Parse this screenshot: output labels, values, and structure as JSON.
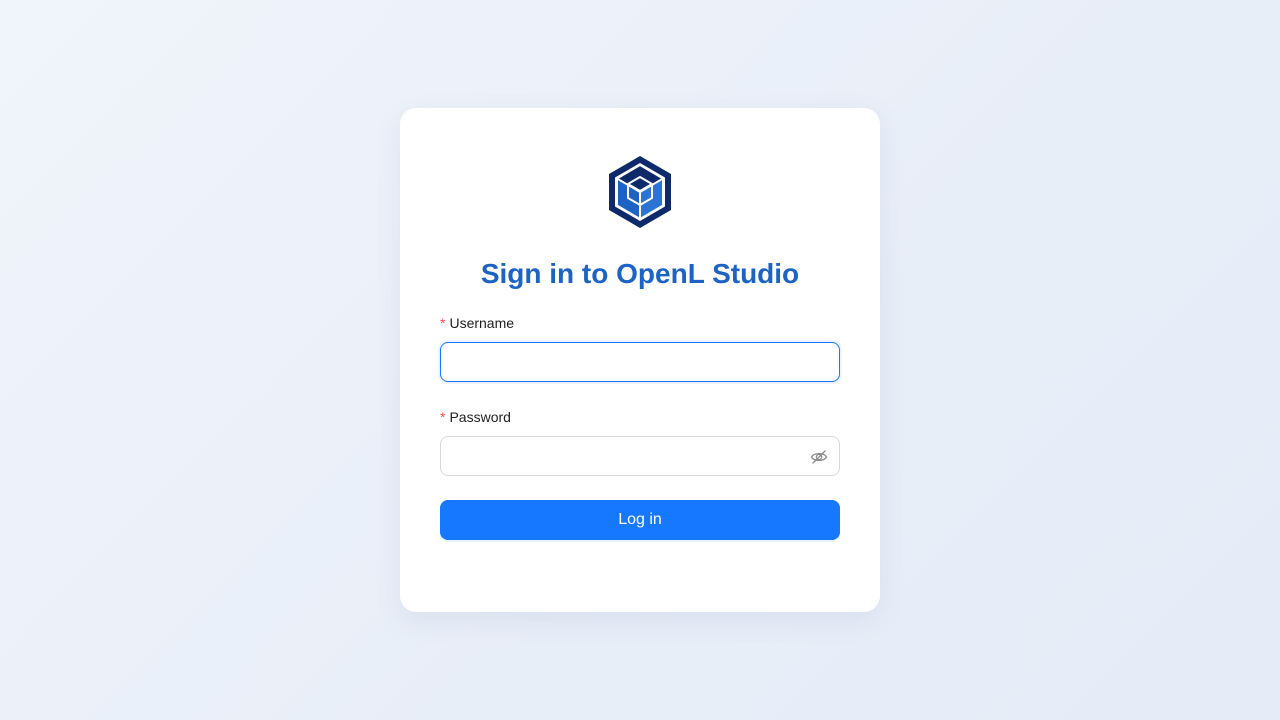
{
  "title": "Sign in to OpenL Studio",
  "logo": {
    "icon": "hexagon-cube-logo-icon",
    "color_dark": "#0f2a6b",
    "color_mid": "#1c63c4"
  },
  "form": {
    "username": {
      "label": "Username",
      "required_mark": "*",
      "value": "",
      "placeholder": "",
      "focused": true
    },
    "password": {
      "label": "Password",
      "required_mark": "*",
      "value": "",
      "placeholder": "",
      "toggle_icon": "eye-slash-icon"
    },
    "submit_label": "Log in"
  },
  "colors": {
    "accent": "#1677ff",
    "title": "#1c63c4",
    "required": "#ff4d4f"
  }
}
